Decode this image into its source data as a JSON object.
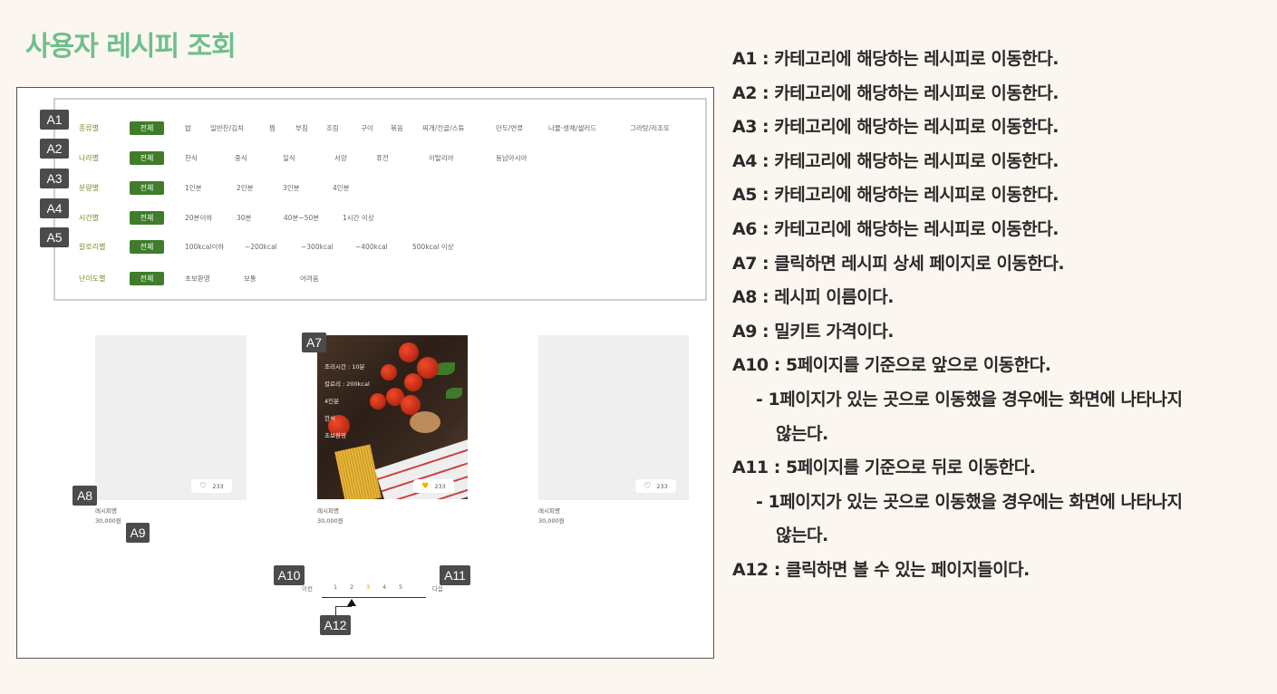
{
  "page_title": "사용자 레시피 조회",
  "filters": [
    {
      "label": "종류별",
      "all": "전체",
      "options": [
        "밥",
        "일반찬/김치",
        "찜",
        "부침",
        "조림",
        "구이",
        "볶음",
        "찌개/전골/스튜",
        "만두/면류",
        "나물·생채/샐러드",
        "그라탕/리조또"
      ]
    },
    {
      "label": "나라별",
      "all": "전체",
      "options": [
        "한식",
        "중식",
        "일식",
        "서양",
        "퓨전",
        "이탈리아",
        "동남아시아"
      ]
    },
    {
      "label": "분량별",
      "all": "전체",
      "options": [
        "1인분",
        "2인분",
        "3인분",
        "4인분"
      ]
    },
    {
      "label": "시간별",
      "all": "전체",
      "options": [
        "20분이하",
        "30분",
        "40분~50분",
        "1시간 이상"
      ]
    },
    {
      "label": "칼로리별",
      "all": "전체",
      "options": [
        "100kcal이하",
        "~200kcal",
        "~300kcal",
        "~400kcal",
        "500kcal 이상"
      ]
    },
    {
      "label": "난이도별",
      "all": "전체",
      "options": [
        "초보환영",
        "보통",
        "어려움"
      ]
    }
  ],
  "cards": [
    {
      "name": "레시피명",
      "price": "30,000원",
      "likes": "233"
    },
    {
      "name": "레시피명",
      "price": "30,000원",
      "likes": "233",
      "details": [
        "조리시간 : 10분",
        "칼로리 : 200kcal",
        "4인분",
        "한식",
        "초보환영"
      ]
    },
    {
      "name": "레시피명",
      "price": "30,000원",
      "likes": "233"
    }
  ],
  "pagination": {
    "prev": "이전",
    "next": "다음",
    "pages": [
      "1",
      "2",
      "3",
      "4",
      "5"
    ]
  },
  "badges": [
    "A1",
    "A2",
    "A3",
    "A4",
    "A5",
    "A7",
    "A8",
    "A9",
    "A10",
    "A11",
    "A12"
  ],
  "annotations": [
    {
      "text": "A1 : 카테고리에 해당하는 레시피로 이동한다.",
      "style": "main"
    },
    {
      "text": "A2 : 카테고리에 해당하는 레시피로 이동한다.",
      "style": "main"
    },
    {
      "text": "A3 : 카테고리에 해당하는 레시피로 이동한다.",
      "style": "main"
    },
    {
      "text": "A4 : 카테고리에 해당하는 레시피로 이동한다.",
      "style": "main"
    },
    {
      "text": "A5 : 카테고리에 해당하는 레시피로 이동한다.",
      "style": "main"
    },
    {
      "text": "A6 : 카테고리에 해당하는 레시피로 이동한다.",
      "style": "main"
    },
    {
      "text": "A7 : 클릭하면 레시피 상세 페이지로 이동한다.",
      "style": "main"
    },
    {
      "text": "A8 : 레시피 이름이다.",
      "style": "main"
    },
    {
      "text": "A9 : 밀키트 가격이다.",
      "style": "main"
    },
    {
      "text": "A10 : 5페이지를 기준으로 앞으로 이동한다.",
      "style": "main"
    },
    {
      "text": "-  1페이지가 있는 곳으로 이동했을 경우에는 화면에 나타나지",
      "style": "sub"
    },
    {
      "text": "않는다.",
      "style": "cont"
    },
    {
      "text": "A11 : 5페이지를 기준으로 뒤로 이동한다.",
      "style": "main"
    },
    {
      "text": "-  1페이지가 있는 곳으로 이동했을 경우에는 화면에 나타나지",
      "style": "sub"
    },
    {
      "text": "않는다.",
      "style": "cont"
    },
    {
      "text": "A12 : 클릭하면 볼 수 있는 페이지들이다.",
      "style": "main"
    }
  ]
}
